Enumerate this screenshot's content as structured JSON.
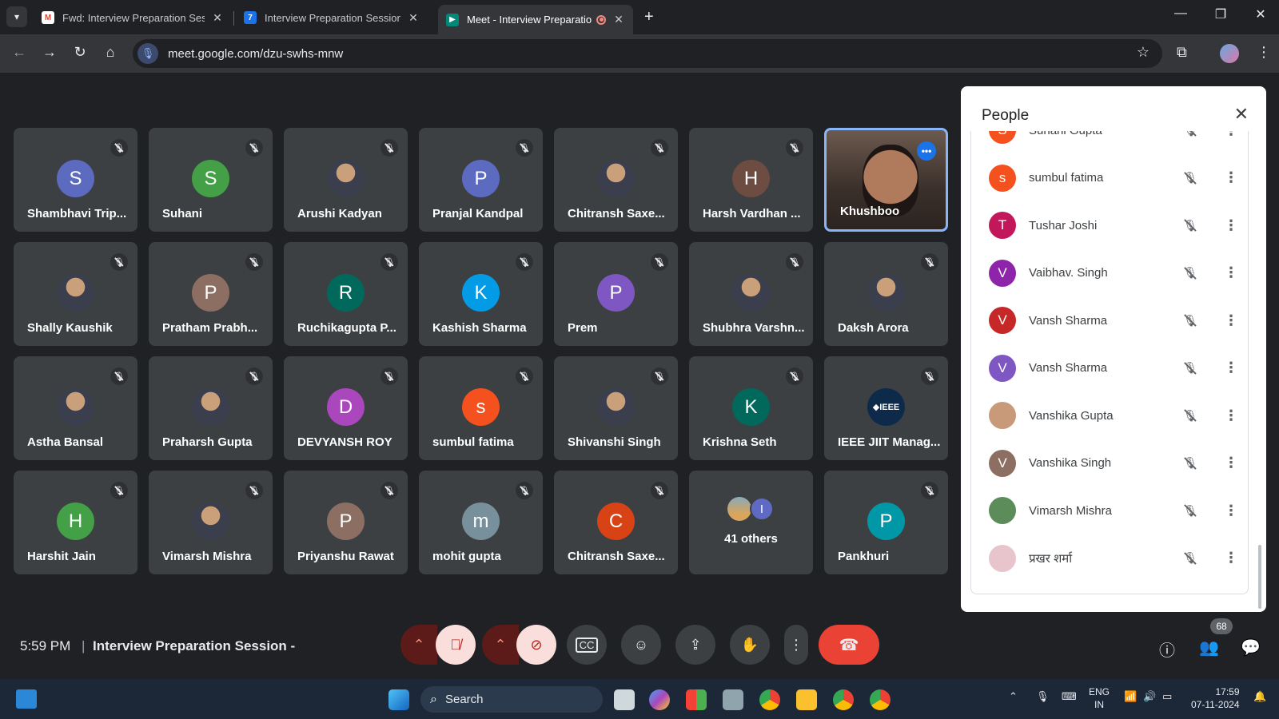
{
  "browser": {
    "tabs": [
      {
        "label": "Fwd: Interview Preparation Sess",
        "favicon": "gmail-icon"
      },
      {
        "label": "Interview Preparation Session -",
        "favicon": "forms-icon"
      },
      {
        "label": "Meet - Interview Preparatio",
        "favicon": "meet-icon",
        "active": true
      }
    ],
    "url": "meet.google.com/dzu-swhs-mnw"
  },
  "tiles": [
    {
      "name": "Shambhavi Trip...",
      "initial": "S",
      "color": "#5c6bc0"
    },
    {
      "name": "Suhani",
      "initial": "S",
      "color": "#43a047"
    },
    {
      "name": "Arushi Kadyan",
      "initial": "",
      "color": "photo"
    },
    {
      "name": "Pranjal Kandpal",
      "initial": "P",
      "color": "#5c6bc0"
    },
    {
      "name": "Chitransh Saxe...",
      "initial": "",
      "color": "photo"
    },
    {
      "name": "Harsh Vardhan ...",
      "initial": "H",
      "color": "#6d4c41"
    },
    {
      "name": "Khushboo",
      "initial": "",
      "color": "video"
    },
    {
      "name": "Shally Kaushik",
      "initial": "",
      "color": "photo"
    },
    {
      "name": "Pratham Prabh...",
      "initial": "P",
      "color": "#8d6e63"
    },
    {
      "name": "Ruchikagupta P...",
      "initial": "R",
      "color": "#00695c"
    },
    {
      "name": "Kashish Sharma",
      "initial": "K",
      "color": "#039be5"
    },
    {
      "name": "Prem",
      "initial": "P",
      "color": "#7e57c2"
    },
    {
      "name": "Shubhra Varshn...",
      "initial": "",
      "color": "photo"
    },
    {
      "name": "Daksh Arora",
      "initial": "",
      "color": "photo"
    },
    {
      "name": "Astha Bansal",
      "initial": "",
      "color": "photo"
    },
    {
      "name": "Praharsh Gupta",
      "initial": "",
      "color": "photo"
    },
    {
      "name": "DEVYANSH ROY",
      "initial": "D",
      "color": "#ab47bc"
    },
    {
      "name": "sumbul fatima",
      "initial": "s",
      "color": "#f4511e"
    },
    {
      "name": "Shivanshi Singh",
      "initial": "",
      "color": "photo"
    },
    {
      "name": "Krishna Seth",
      "initial": "K",
      "color": "#00695c"
    },
    {
      "name": "IEEE JIIT Manag...",
      "initial": "◆IEEE",
      "color": "#0d2a4a"
    },
    {
      "name": "Harshit Jain",
      "initial": "H",
      "color": "#43a047"
    },
    {
      "name": "Vimarsh Mishra",
      "initial": "",
      "color": "photo"
    },
    {
      "name": "Priyanshu Rawat",
      "initial": "P",
      "color": "#8d6e63"
    },
    {
      "name": "mohit gupta",
      "initial": "m",
      "color": "#78909c"
    },
    {
      "name": "Chitransh Saxe...",
      "initial": "C",
      "color": "#d84315"
    },
    {
      "name": "41 others",
      "initial": "I",
      "color": "others"
    },
    {
      "name": "Pankhuri",
      "initial": "P",
      "color": "#0097a7"
    }
  ],
  "people_panel": {
    "title": "People",
    "participants": [
      {
        "name": "Suhani Gupta",
        "initial": "S",
        "color": "#f4511e"
      },
      {
        "name": "sumbul fatima",
        "initial": "s",
        "color": "#f4511e"
      },
      {
        "name": "Tushar Joshi",
        "initial": "T",
        "color": "#c2185b"
      },
      {
        "name": "Vaibhav. Singh",
        "initial": "V",
        "color": "#8e24aa"
      },
      {
        "name": "Vansh Sharma",
        "initial": "V",
        "color": "#c62828"
      },
      {
        "name": "Vansh Sharma",
        "initial": "V",
        "color": "#7e57c2"
      },
      {
        "name": "Vanshika Gupta",
        "initial": "",
        "color": "#c89a7a"
      },
      {
        "name": "Vanshika Singh",
        "initial": "V",
        "color": "#8d6e63"
      },
      {
        "name": "Vimarsh Mishra",
        "initial": "",
        "color": "#5b8c5a"
      },
      {
        "name": "प्रखर शर्मा",
        "initial": "",
        "color": "#e8c4cc"
      }
    ]
  },
  "meeting_bar": {
    "time": "5:59 PM",
    "separator": "|",
    "meeting_name": "Interview Preparation Session -",
    "participant_count": "68"
  },
  "taskbar": {
    "search_label": "Search",
    "lang_top": "ENG",
    "lang_bottom": "IN",
    "clock_time": "17:59",
    "clock_date": "07-11-2024"
  }
}
